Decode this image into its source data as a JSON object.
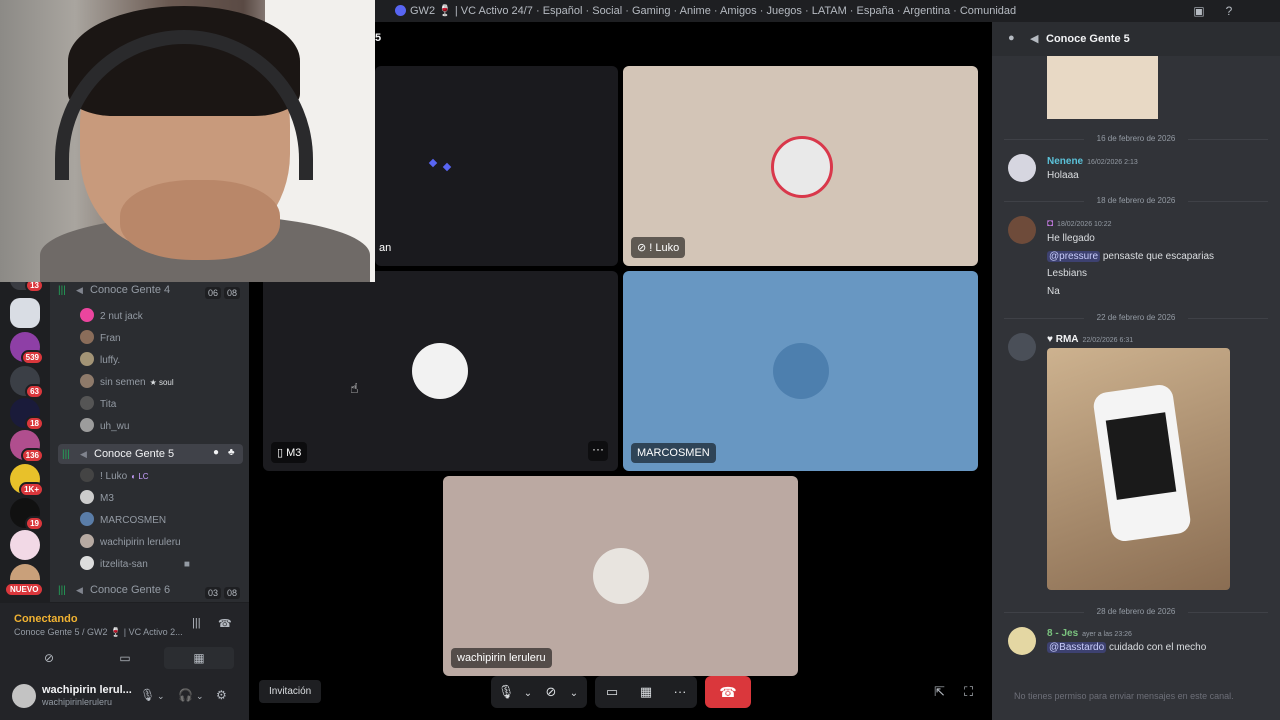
{
  "window": {
    "title": "GW2 🍷 | VC Activo 24/7 · Español · Social · Gaming · Anime · Amigos · Juegos · LATAM · España · Argentina · Comunidad"
  },
  "rail": {
    "badges": [
      "13",
      "539",
      "63",
      "18",
      "136",
      "1K+",
      "19",
      "NUEVO"
    ]
  },
  "channels": {
    "ch4": {
      "name": "Conoce Gente 4",
      "count_a": "06",
      "count_b": "08"
    },
    "ch4_members": [
      {
        "name": "2 nut jack",
        "tag": ""
      },
      {
        "name": "Fran",
        "tag": ""
      },
      {
        "name": "luffy.",
        "tag": ""
      },
      {
        "name": "sin semen",
        "tag": "soul"
      },
      {
        "name": "Tita",
        "tag": ""
      },
      {
        "name": "uh_wu",
        "tag": ""
      }
    ],
    "ch5": {
      "name": "Conoce Gente 5"
    },
    "ch5_members": [
      {
        "name": "! Luko",
        "tag": "LC"
      },
      {
        "name": "M3",
        "tag": ""
      },
      {
        "name": "MARCOSMEN",
        "tag": ""
      },
      {
        "name": "wachipirin leruleru",
        "tag": ""
      },
      {
        "name": "itzelita-san",
        "tag": ""
      }
    ],
    "ch6": {
      "name": "Conoce Gente 6",
      "count_a": "03",
      "count_b": "08"
    }
  },
  "voice_panel": {
    "status": "Conectando",
    "location": "Conoce Gente 5 / GW2 🍷 | VC Activo 2..."
  },
  "user": {
    "display": "wachipirin lerul...",
    "handle": "wachipirinleruleru"
  },
  "stage": {
    "title_fragment": "5",
    "tiles": [
      {
        "label": "an"
      },
      {
        "label": "! Luko"
      },
      {
        "label": "M3"
      },
      {
        "label": "MARCOSMEN"
      },
      {
        "label": "wachipirin leruleru"
      }
    ],
    "invite_label": "Invitación"
  },
  "chat": {
    "title": "Conoce Gente 5",
    "dividers": [
      "16 de febrero de 2026",
      "18 de febrero de 2026",
      "22 de febrero de 2026",
      "28 de febrero de 2026"
    ],
    "messages": [
      {
        "author": "Nenene",
        "time": "16/02/2026 2:13",
        "lines": [
          "Holaaa"
        ]
      },
      {
        "author": "",
        "time": "18/02/2026 10:22",
        "lines": [
          "He llegado",
          "pensaste que escaparias",
          "Lesbians",
          "Na"
        ],
        "mention": "@pressure"
      },
      {
        "author": "",
        "tag": "RMA",
        "time": "22/02/2026 6:31",
        "lines": []
      },
      {
        "author": "8 - Jes",
        "time": "ayer a las 23:26",
        "lines": [
          "cuidado con el mecho"
        ],
        "mention": "@Basstardo"
      }
    ],
    "input_placeholder": "No tienes permiso para enviar mensajes en este canal."
  },
  "colors": {
    "accent": "#5865f2",
    "online": "#23a559",
    "danger": "#da373c",
    "connecting": "#f0b232"
  }
}
